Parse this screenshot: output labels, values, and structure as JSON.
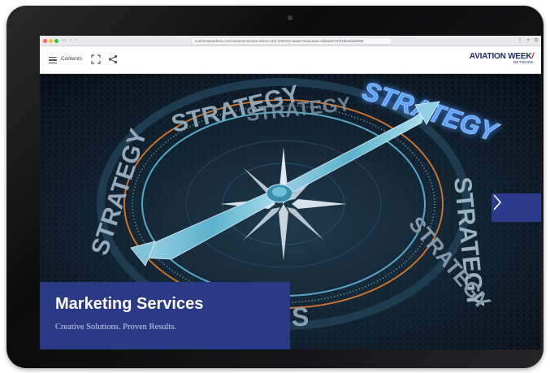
{
  "browser": {
    "url": "a.informamarkets.com/customer/vendor-select-card-2022110 aaaa7?exclusive=6d3asd71e2f16b4dad0098",
    "nav_back": "‹",
    "nav_forward": "›",
    "sidebar_icon": "▭",
    "toolbar_right": [
      "⇧",
      "+",
      "⧉"
    ]
  },
  "toolbar": {
    "contents_label": "Contents",
    "logo_text": "AVIATION WEEK",
    "logo_subtext": "NETWORK",
    "logo_accent_color": "#d1202a"
  },
  "hero": {
    "background_words": [
      "STRATEGY",
      "STRATEGY",
      "STRATEGY",
      "STRATEGY",
      "STRATEGY",
      "S"
    ],
    "highlight_word": "STRATEGY"
  },
  "panel": {
    "title": "Marketing Services",
    "subtitle": "Creative Solutions. Proven Results."
  },
  "next_button": {
    "glyph": "›"
  },
  "colors": {
    "brand_blue": "#2b3a86",
    "next_button": "#2c3b8e",
    "neon_blue": "#3f8cff",
    "compass_ring_orange": "#d8772e"
  }
}
